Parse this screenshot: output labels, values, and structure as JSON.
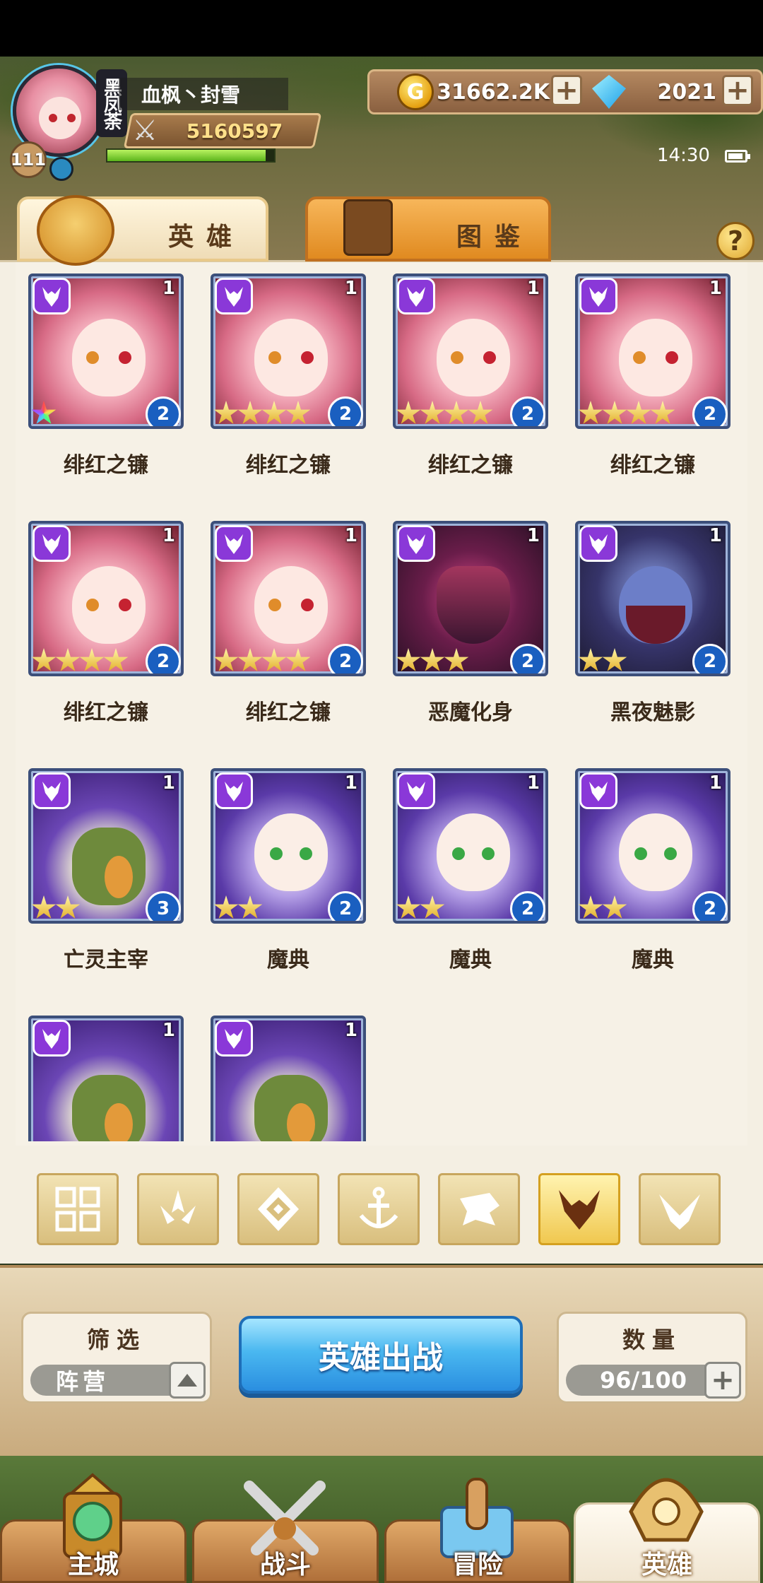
{
  "player": {
    "name": "血枫丶封雪",
    "level": "111",
    "guild_tag": "黑凤荼",
    "power": "5160597",
    "exp_fraction": 0.95
  },
  "currency": {
    "gold": "31662.2K",
    "gems": "2021"
  },
  "status": {
    "time": "14:30"
  },
  "tabs": [
    {
      "label": "英雄",
      "active": true
    },
    {
      "label": "图鉴",
      "active": false
    }
  ],
  "help_label": "?",
  "heroes": [
    {
      "name": "绯红之镰",
      "level": "1",
      "stars": 1,
      "rainbow": true,
      "rank": "2",
      "art": "pink"
    },
    {
      "name": "绯红之镰",
      "level": "1",
      "stars": 4,
      "rainbow": false,
      "rank": "2",
      "art": "pink"
    },
    {
      "name": "绯红之镰",
      "level": "1",
      "stars": 4,
      "rainbow": false,
      "rank": "2",
      "art": "pink"
    },
    {
      "name": "绯红之镰",
      "level": "1",
      "stars": 4,
      "rainbow": false,
      "rank": "2",
      "art": "pink"
    },
    {
      "name": "绯红之镰",
      "level": "1",
      "stars": 4,
      "rainbow": false,
      "rank": "2",
      "art": "pink"
    },
    {
      "name": "绯红之镰",
      "level": "1",
      "stars": 4,
      "rainbow": false,
      "rank": "2",
      "art": "pink"
    },
    {
      "name": "恶魔化身",
      "level": "1",
      "stars": 3,
      "rainbow": false,
      "rank": "2",
      "art": "demon"
    },
    {
      "name": "黑夜魅影",
      "level": "1",
      "stars": 2,
      "rainbow": false,
      "rank": "2",
      "art": "shadow"
    },
    {
      "name": "亡灵主宰",
      "level": "1",
      "stars": 2,
      "rainbow": false,
      "rank": "3",
      "art": "wizard"
    },
    {
      "name": "魔典",
      "level": "1",
      "stars": 2,
      "rainbow": false,
      "rank": "2",
      "art": "tome"
    },
    {
      "name": "魔典",
      "level": "1",
      "stars": 2,
      "rainbow": false,
      "rank": "2",
      "art": "tome"
    },
    {
      "name": "魔典",
      "level": "1",
      "stars": 2,
      "rainbow": false,
      "rank": "2",
      "art": "tome"
    },
    {
      "name": "",
      "level": "1",
      "stars": 0,
      "rainbow": false,
      "rank": "",
      "art": "wizard"
    },
    {
      "name": "",
      "level": "1",
      "stars": 0,
      "rainbow": false,
      "rank": "",
      "art": "wizard"
    }
  ],
  "faction_filters": [
    {
      "icon": "all-grid-icon",
      "active": false
    },
    {
      "icon": "nature-faction-icon",
      "active": false
    },
    {
      "icon": "order-faction-icon",
      "active": false
    },
    {
      "icon": "anchor-faction-icon",
      "active": false
    },
    {
      "icon": "beast-faction-icon",
      "active": false
    },
    {
      "icon": "demon-faction-icon",
      "active": true
    },
    {
      "icon": "light-faction-icon",
      "active": false
    }
  ],
  "controls": {
    "filter_title": "筛选",
    "filter_value": "阵营",
    "deploy_label": "英雄出战",
    "count_title": "数量",
    "count_value": "96/100"
  },
  "nav": [
    {
      "label": "主城",
      "active": false
    },
    {
      "label": "战斗",
      "active": false
    },
    {
      "label": "冒险",
      "active": false
    },
    {
      "label": "英雄",
      "active": true
    }
  ],
  "colors": {
    "faction_purple": "#8a38d8",
    "deploy_blue": "#2a8ee0",
    "gold_text": "#ffe08a"
  }
}
